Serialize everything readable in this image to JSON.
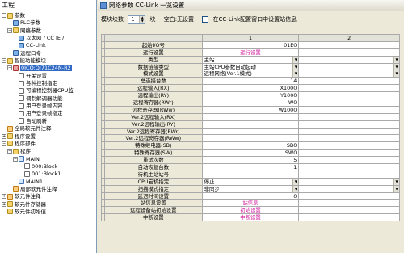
{
  "tree": {
    "title": "工程",
    "nodes": [
      {
        "label": "参数",
        "indent": 0,
        "icon": "folder",
        "expander": "−"
      },
      {
        "label": "PLC参数",
        "indent": 1,
        "icon": "param"
      },
      {
        "label": "网络参数",
        "indent": 1,
        "icon": "folder",
        "expander": "−"
      },
      {
        "label": "以太网 / CC IE /",
        "indent": 2,
        "icon": "param"
      },
      {
        "label": "CC-Link",
        "indent": 2,
        "icon": "param"
      },
      {
        "label": "远程口令",
        "indent": 1,
        "icon": "param"
      },
      {
        "label": "智能功能模块",
        "indent": 0,
        "icon": "folder",
        "expander": "−"
      },
      {
        "label": "0ICO:QJ71C24N-R2",
        "indent": 1,
        "icon": "redchip",
        "selected": true,
        "expander": "−"
      },
      {
        "label": "开关设置",
        "indent": 2,
        "icon": "sheet"
      },
      {
        "label": "各种控制指定",
        "indent": 2,
        "icon": "sheet"
      },
      {
        "label": "可编程控制器CPU监",
        "indent": 2,
        "icon": "sheet"
      },
      {
        "label": "调制解调器功能",
        "indent": 2,
        "icon": "sheet"
      },
      {
        "label": "用户登录帧内容",
        "indent": 2,
        "icon": "sheet"
      },
      {
        "label": "用户登录帧指定",
        "indent": 2,
        "icon": "sheet"
      },
      {
        "label": "自动刷新",
        "indent": 2,
        "icon": "sheet"
      },
      {
        "label": "全局软元件注释",
        "indent": 0,
        "icon": "orange"
      },
      {
        "label": "程序设置",
        "indent": 0,
        "icon": "folder",
        "expander": "+"
      },
      {
        "label": "程序部件",
        "indent": 0,
        "icon": "folder",
        "expander": "−"
      },
      {
        "label": "程序",
        "indent": 1,
        "icon": "folder",
        "expander": "−"
      },
      {
        "label": "MAIN",
        "indent": 2,
        "icon": "prog",
        "expander": "−"
      },
      {
        "label": "000:Block",
        "indent": 3,
        "icon": "sheet"
      },
      {
        "label": "001:Block1",
        "indent": 3,
        "icon": "sheet"
      },
      {
        "label": "MAIN1",
        "indent": 2,
        "icon": "prog"
      },
      {
        "label": "局部软元件注释",
        "indent": 1,
        "icon": "orange"
      },
      {
        "label": "软元件注释",
        "indent": 0,
        "icon": "orange",
        "expander": "+"
      },
      {
        "label": "软元件存储器",
        "indent": 0,
        "icon": "folder",
        "expander": "+"
      },
      {
        "label": "软元件初始值",
        "indent": 0,
        "icon": "folder"
      }
    ]
  },
  "panel": {
    "title": "网络参数   CC-Link 一览设置",
    "modules_label": "模块块数",
    "modules_value": "1",
    "modules_unit": "块",
    "blank_label": "空白:无设置",
    "checkbox_label": "在CC-Link配置窗口中设置站信息"
  },
  "grid": {
    "col_headers": [
      "1",
      "2"
    ],
    "rows": [
      {
        "label": "起始I/O号",
        "v1": "01E0",
        "t1": "num",
        "t2": "blank"
      },
      {
        "label": "运行设置",
        "v1": "运行设置",
        "t1": "link",
        "t2": "blank"
      },
      {
        "label": "类型",
        "v1": "主站",
        "t1": "dd",
        "t2": "dd"
      },
      {
        "label": "数据链接类型",
        "v1": "主站CPU参数自动起动",
        "t1": "dd",
        "t2": "dd"
      },
      {
        "label": "模式设置",
        "v1": "远程网络(Ver.1模式)",
        "t1": "dd",
        "t2": "dd"
      },
      {
        "label": "总连接台数",
        "v1": "14",
        "t1": "num",
        "t2": "blank"
      },
      {
        "label": "远程输入(RX)",
        "v1": "X1000",
        "t1": "num",
        "t2": "blank"
      },
      {
        "label": "远程输出(RY)",
        "v1": "Y1000",
        "t1": "num",
        "t2": "blank"
      },
      {
        "label": "远程寄存器(RWr)",
        "v1": "W0",
        "t1": "num",
        "t2": "blank"
      },
      {
        "label": "远程寄存器(RWw)",
        "v1": "W1000",
        "t1": "num",
        "t2": "blank"
      },
      {
        "label": "Ver.2远程输入(RX)",
        "v1": "",
        "t1": "num",
        "t2": "blank"
      },
      {
        "label": "Ver.2远程输出(RY)",
        "v1": "",
        "t1": "num",
        "t2": "blank"
      },
      {
        "label": "Ver.2远程寄存器(RWr)",
        "v1": "",
        "t1": "num",
        "t2": "blank"
      },
      {
        "label": "Ver.2远程寄存器(RWw)",
        "v1": "",
        "t1": "num",
        "t2": "blank"
      },
      {
        "label": "特殊继电器(SB)",
        "v1": "SB0",
        "t1": "num",
        "t2": "blank"
      },
      {
        "label": "特殊寄存器(SW)",
        "v1": "SW0",
        "t1": "num",
        "t2": "blank"
      },
      {
        "label": "重试次数",
        "v1": "5",
        "t1": "num",
        "t2": "blank"
      },
      {
        "label": "自动恢复台数",
        "v1": "1",
        "t1": "num",
        "t2": "blank"
      },
      {
        "label": "待机主站站号",
        "v1": "",
        "t1": "num",
        "t2": "blank"
      },
      {
        "label": "CPU宕机指定",
        "v1": "停止",
        "t1": "dd",
        "t2": "dd"
      },
      {
        "label": "扫描模式指定",
        "v1": "非同步",
        "t1": "dd",
        "t2": "dd"
      },
      {
        "label": "延迟时间设置",
        "v1": "0",
        "t1": "num",
        "t2": "blank"
      },
      {
        "label": "站信息设置",
        "v1": "站信息",
        "t1": "link",
        "t2": "blank"
      },
      {
        "label": "远程设备站初始设置",
        "v1": "初始设置",
        "t1": "link",
        "t2": "blank"
      },
      {
        "label": "中断设置",
        "v1": "中断设置",
        "t1": "link",
        "t2": "blank"
      }
    ]
  }
}
